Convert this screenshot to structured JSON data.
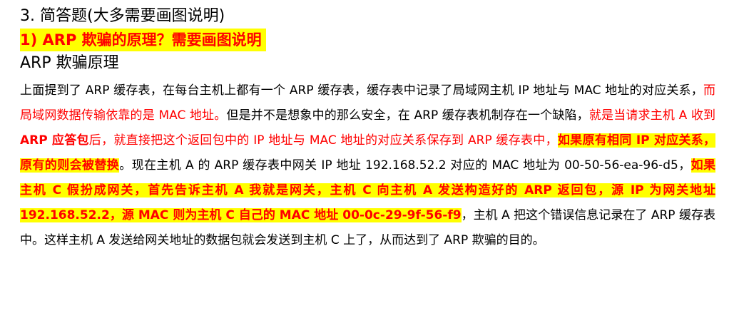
{
  "section_heading": "3.  简答题(大多需要画图说明)",
  "question_title": "1)  ARP 欺骗的原理？需要画图说明",
  "subsection_title": "ARP 欺骗原理",
  "paragraph": {
    "seg1": "上面提到了 ARP 缓存表，在每台主机上都有一个 ARP 缓存表，缓存表中记录了局域网主机 IP 地址与 MAC 地址的对应关系，",
    "seg2": "而局域网数据传输依靠的是 MAC 地址。",
    "seg3": "但是并不是想象中的那么安全，在 ARP 缓存表机制存在一个缺陷，",
    "seg4": "就是当请求主机 A 收到 ",
    "seg5": "ARP 应答包",
    "seg6": "后，就直接把这个返回包中的 IP 地址与 MAC 地址的对应关系保存到 ARP 缓存表中，",
    "seg7": "如果原有相同 IP 对应关系，原有的则会被替换",
    "seg8": "。现在主机 A 的 ARP 缓存表中网关 IP 地址 192.168.52.2 对应的 MAC 地址为 00-50-56-ea-96-d5，",
    "seg9": "如果主机 C 假扮成网关，首先告诉主机 A 我就是网关，主机 C 向主机 A 发送构造好的 ARP 返回包，源 IP 为网关地址 192.168.52.2，源 MAC 则为主机 C 自己的 MAC 地址 00-0c-29-9f-56-f9",
    "seg10": "，主机 A 把这个错误信息记录在了 ARP 缓存表中。这样主机 A 发送给网关地址的数据包就会发送到主机 C 上了，从而达到了 ARP 欺骗的目的。"
  },
  "colors": {
    "emphasis_red": "#ff0000",
    "highlight_yellow": "#ffff00",
    "text": "#000000"
  }
}
